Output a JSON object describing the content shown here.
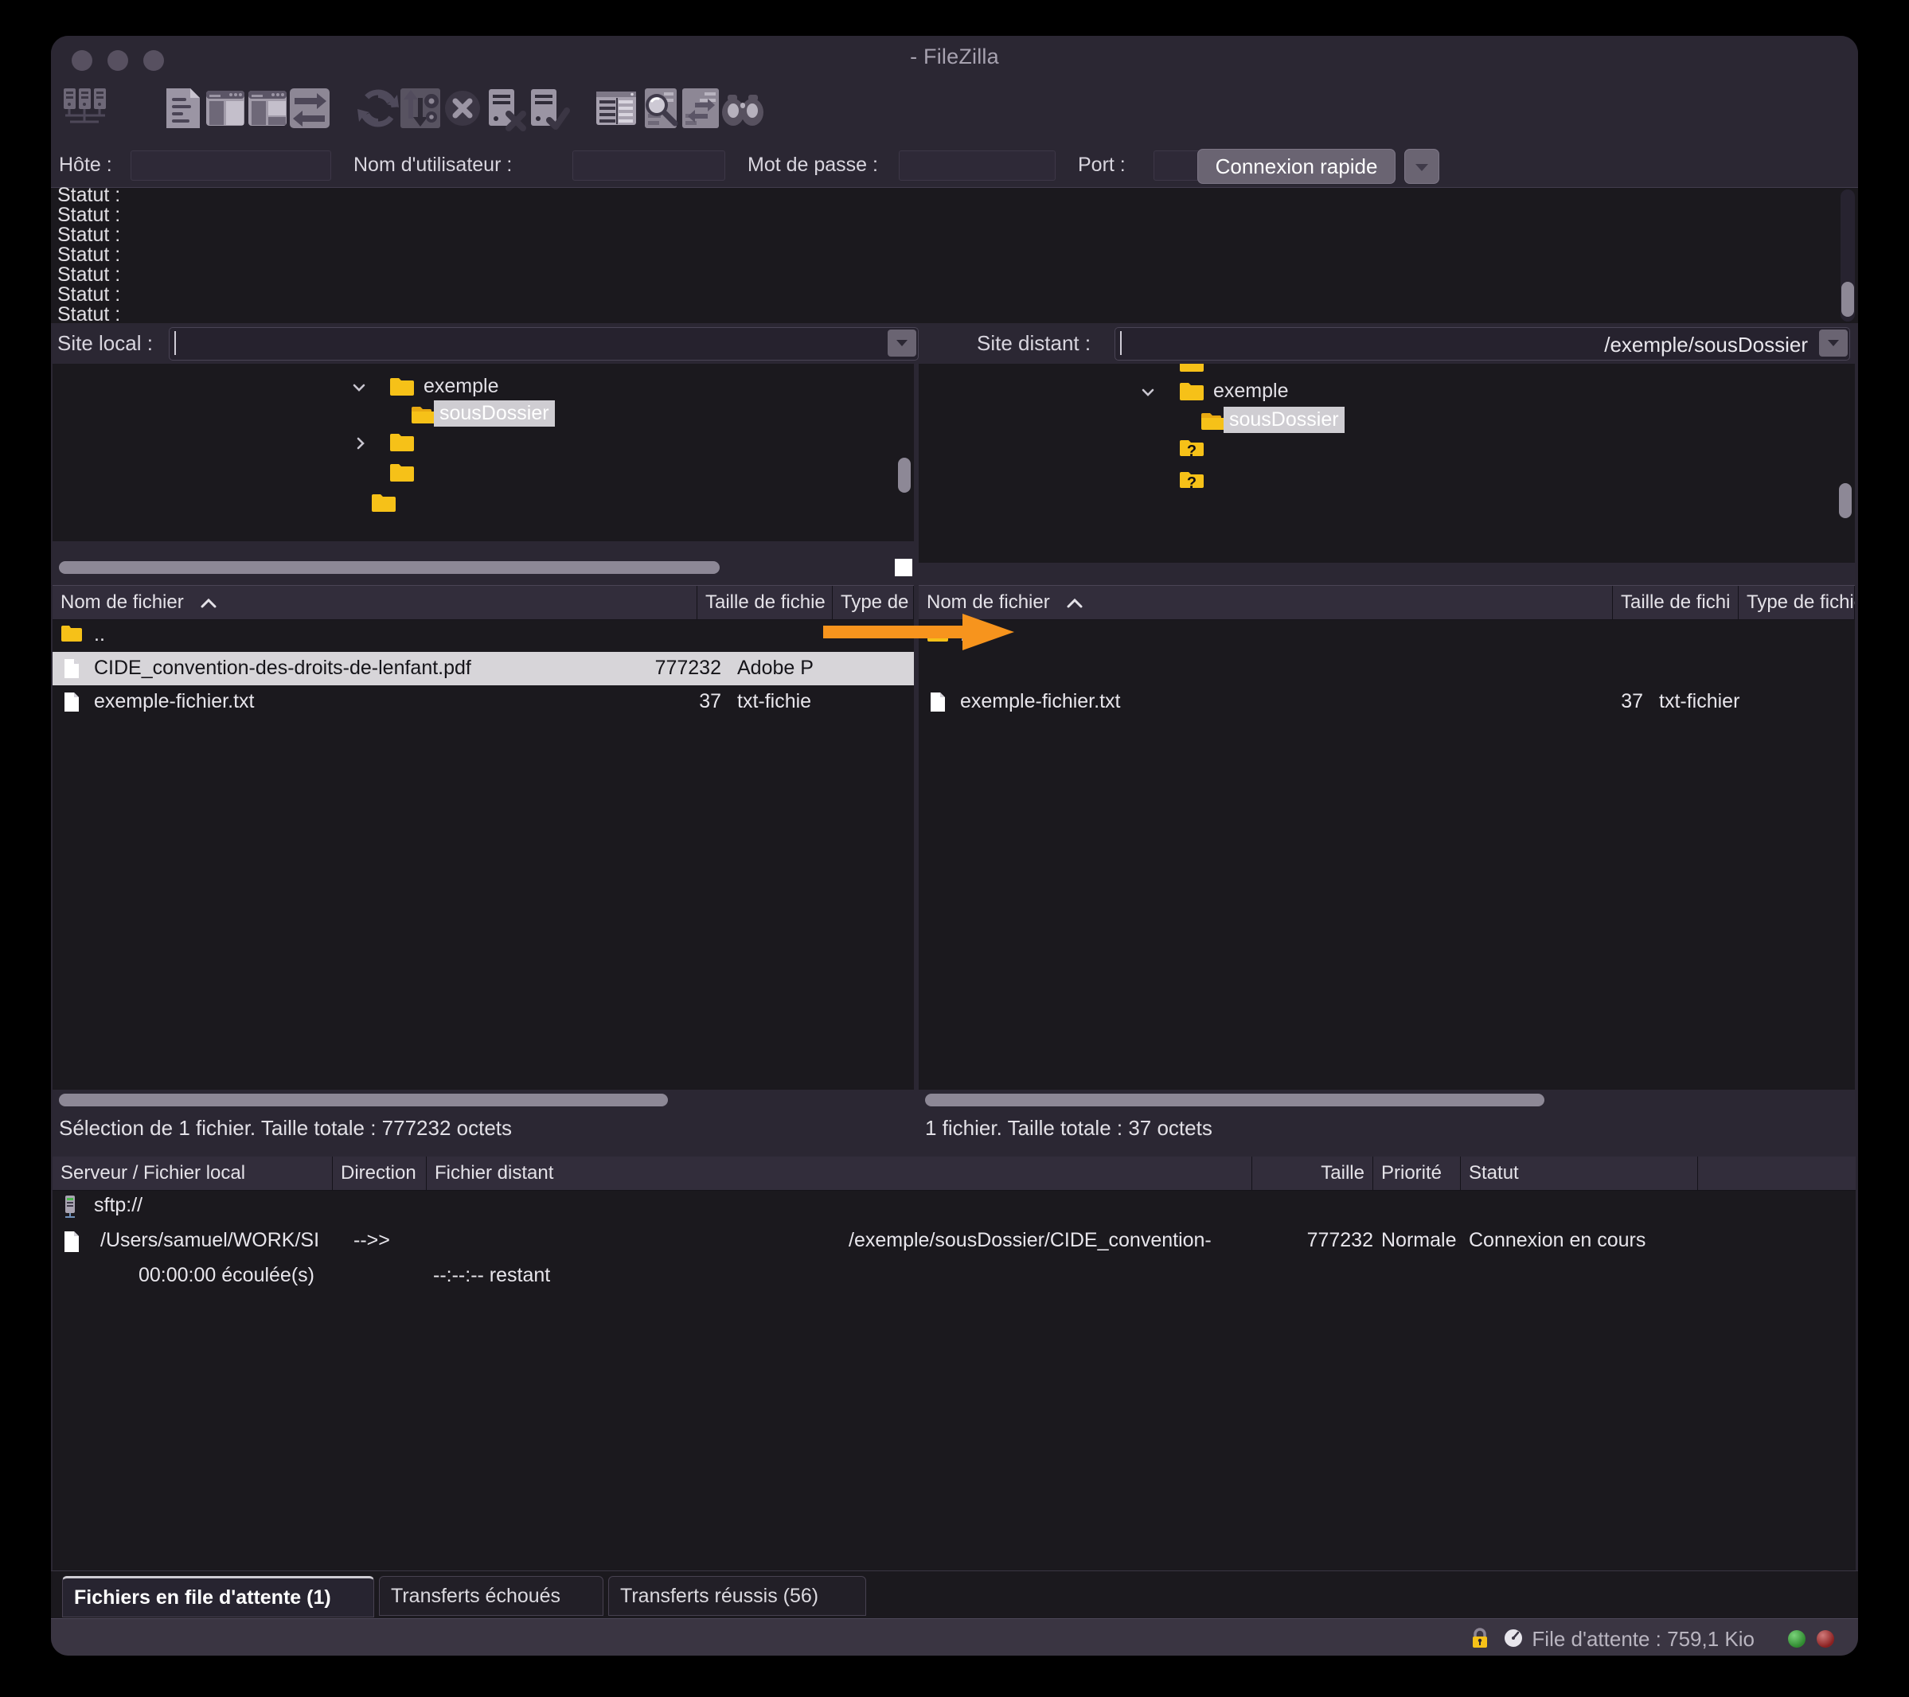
{
  "window": {
    "title": "- FileZilla",
    "traffic_lights": [
      "close",
      "minimize",
      "zoom"
    ]
  },
  "toolbar": {
    "items": [
      {
        "name": "site-manager-icon",
        "label": "Gestionnaire de Sites"
      },
      {
        "name": "toggle-message-log-icon",
        "label": "Afficher/masquer le journal des messages"
      },
      {
        "name": "toggle-local-tree-icon",
        "label": "Afficher/masquer l'arborescence locale"
      },
      {
        "name": "toggle-remote-tree-icon",
        "label": "Afficher/masquer l'arborescence distante"
      },
      {
        "name": "toggle-transfer-queue-icon",
        "label": "Afficher/masquer la file de transfert"
      },
      {
        "name": "refresh-icon",
        "label": "Actualiser"
      },
      {
        "name": "process-queue-icon",
        "label": "Traiter la file d'attente"
      },
      {
        "name": "cancel-icon",
        "label": "Annuler l'opération en cours"
      },
      {
        "name": "disconnect-icon",
        "label": "Déconnexion du serveur"
      },
      {
        "name": "reconnect-icon",
        "label": "Reconnexion au dernier serveur"
      },
      {
        "name": "filter-icon",
        "label": "Filtres de noms de fichiers"
      },
      {
        "name": "compare-directories-icon",
        "label": "Comparaison de répertoires"
      },
      {
        "name": "synchronized-browsing-icon",
        "label": "Navigation synchronisée"
      },
      {
        "name": "search-remote-files-icon",
        "label": "Recherche de fichiers distants"
      }
    ]
  },
  "quickconnect": {
    "host_label": "Hôte :",
    "host_value": "",
    "username_label": "Nom d'utilisateur :",
    "username_value": "",
    "password_label": "Mot de passe :",
    "password_value": "",
    "port_label": "Port :",
    "port_value": "",
    "connect_button": "Connexion rapide",
    "dropdown_icon": "chevron-down-icon"
  },
  "status_log": {
    "lines": [
      "Statut :",
      "Statut :",
      "Statut :",
      "Statut :",
      "Statut :",
      "Statut :",
      "Statut :"
    ]
  },
  "local": {
    "site_label": "Site local :",
    "site_value": "",
    "tree": [
      {
        "label": "exemple",
        "indent": 0,
        "twisty": "chevron-down-icon",
        "selected": false,
        "folder": "folder-icon"
      },
      {
        "label": "sousDossier",
        "indent": 1,
        "twisty": "",
        "selected": true,
        "folder": "folder-open-icon"
      },
      {
        "label": "",
        "indent": 0,
        "twisty": "chevron-right-icon",
        "selected": false,
        "folder": "folder-icon"
      },
      {
        "label": "",
        "indent": 0,
        "twisty": "",
        "selected": false,
        "folder": "folder-icon"
      },
      {
        "label": "",
        "indent": 0,
        "twisty": "",
        "selected": false,
        "folder": "folder-icon"
      }
    ],
    "columns": [
      {
        "label": "Nom de fichier",
        "sort": "ascending"
      },
      {
        "label": "Taille de fichie",
        "sort": ""
      },
      {
        "label": "Type de f",
        "sort": ""
      }
    ],
    "rows": [
      {
        "icon": "folder-icon",
        "name": "..",
        "size": "",
        "type": "",
        "selected": false
      },
      {
        "icon": "file-icon",
        "name": "CIDE_convention-des-droits-de-lenfant.pdf",
        "size": "777232",
        "type": "Adobe P",
        "selected": true
      },
      {
        "icon": "file-icon",
        "name": "exemple-fichier.txt",
        "size": "37",
        "type": "txt-fichie",
        "selected": false
      }
    ],
    "status": "Sélection de 1 fichier. Taille totale : 777232 octets"
  },
  "remote": {
    "site_label": "Site distant :",
    "site_value": "/exemple/sousDossier",
    "tree": [
      {
        "label": "",
        "indent": 0,
        "twisty": "",
        "selected": false,
        "folder": "folder-icon"
      },
      {
        "label": "exemple",
        "indent": 0,
        "twisty": "chevron-down-icon",
        "selected": false,
        "folder": "folder-icon"
      },
      {
        "label": "sousDossier",
        "indent": 1,
        "twisty": "",
        "selected": true,
        "folder": "folder-open-icon"
      },
      {
        "label": "",
        "indent": 0,
        "twisty": "",
        "selected": false,
        "folder": "folder-unknown-icon"
      },
      {
        "label": "",
        "indent": 0,
        "twisty": "",
        "selected": false,
        "folder": "folder-unknown-icon"
      }
    ],
    "columns": [
      {
        "label": "Nom de fichier",
        "sort": "ascending"
      },
      {
        "label": "Taille de fichi",
        "sort": ""
      },
      {
        "label": "Type de fichie",
        "sort": ""
      }
    ],
    "rows": [
      {
        "icon": "folder-icon",
        "name": "..",
        "size": "",
        "type": "",
        "selected": false
      },
      {
        "icon": "file-icon",
        "name": "exemple-fichier.txt",
        "size": "37",
        "type": "txt-fichier",
        "selected": false
      }
    ],
    "status": "1 fichier. Taille totale : 37 octets"
  },
  "queue": {
    "columns": [
      {
        "label": "Serveur / Fichier local"
      },
      {
        "label": "Direction"
      },
      {
        "label": "Fichier distant"
      },
      {
        "label": "Taille"
      },
      {
        "label": "Priorité"
      },
      {
        "label": "Statut"
      }
    ],
    "server_row": {
      "icon": "server-icon",
      "label": "sftp://"
    },
    "transfer_row": {
      "icon": "file-icon",
      "local": "/Users/samuel/WORK/SI",
      "direction": "-->>",
      "remote": "/exemple/sousDossier/CIDE_convention-",
      "size": "777232",
      "priority": "Normale",
      "status": "Connexion en cours"
    },
    "progress_row": {
      "elapsed": "00:00:00 écoulée(s)",
      "remaining": "--:--:-- restant"
    }
  },
  "tabs": [
    {
      "label": "Fichiers en file d'attente (1)",
      "active": true
    },
    {
      "label": "Transferts échoués",
      "active": false
    },
    {
      "label": "Transferts réussis (56)",
      "active": false
    }
  ],
  "statusbar": {
    "lock_icon": "lock-icon",
    "speed_icon": "speedometer-icon",
    "queue_text": "File d'attente : 759,1 Kio",
    "led_green": "#2f8a2f",
    "led_red": "#8a2020"
  },
  "annotation": {
    "arrow": "orange-arrow-right",
    "color": "#F7941D"
  }
}
